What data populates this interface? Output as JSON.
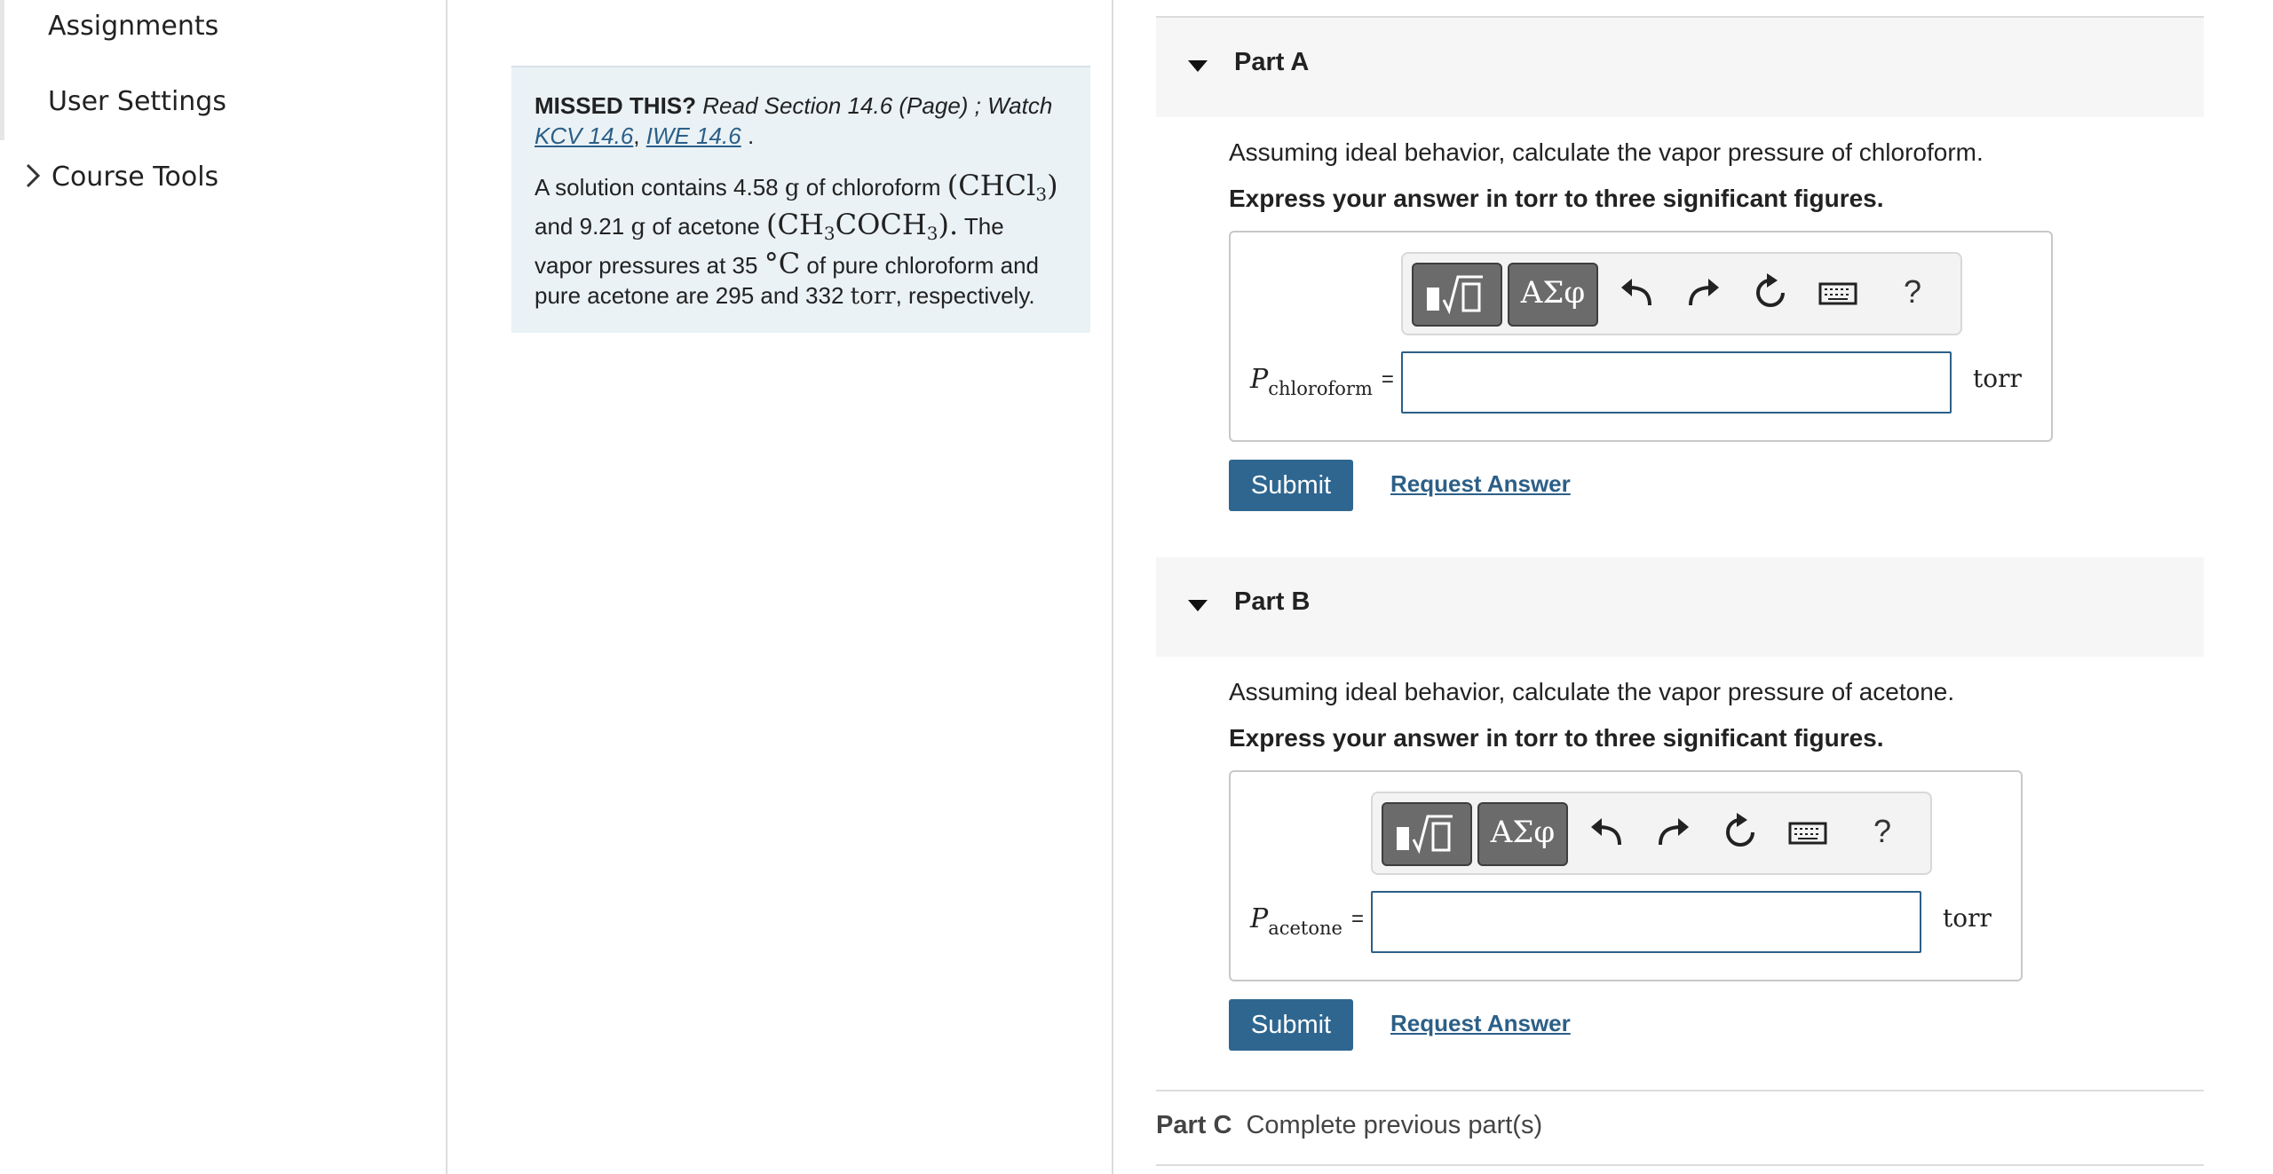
{
  "sidebar": {
    "items": [
      {
        "label": "Assignments"
      },
      {
        "label": "User Settings"
      },
      {
        "label": "Course Tools"
      }
    ]
  },
  "intro": {
    "missed_label": "MISSED THIS?",
    "read_text": "Read Section 14.6 (Page) ; Watch",
    "link1": "KCV 14.6",
    "comma": ",",
    "link2": "IWE 14.6",
    "period": ".",
    "problem": {
      "t1": "A solution contains 4.58",
      "u_g": "g",
      "t2": "of chloroform",
      "chcl3": "(CHCl",
      "sub3": "3",
      "close": ")",
      "t3": "and 9.21",
      "t4": "of acetone",
      "ch3": "(CH",
      "coch": "COCH",
      "close_dot": ").",
      "t5": "The vapor pressures at 35",
      "deg": "°C",
      "t6": "of pure chloroform and pure acetone are 295 and 332",
      "torr": "torr",
      "t7": ", respectively."
    }
  },
  "parts": [
    {
      "title": "Part A",
      "prompt": "Assuming ideal behavior, calculate the vapor pressure of chloroform.",
      "instruction": "Express your answer in torr to three significant figures.",
      "var_symbol": "P",
      "var_sub": "chloroform",
      "equals": "=",
      "value": "",
      "unit": "torr",
      "submit": "Submit",
      "request": "Request Answer",
      "toolbar": {
        "symbols_label": "ΑΣφ",
        "help_label": "?"
      }
    },
    {
      "title": "Part B",
      "prompt": "Assuming ideal behavior, calculate the vapor pressure of acetone.",
      "instruction": "Express your answer in torr to three significant figures.",
      "var_symbol": "P",
      "var_sub": "acetone",
      "equals": "=",
      "value": "",
      "unit": "torr",
      "submit": "Submit",
      "request": "Request Answer",
      "toolbar": {
        "symbols_label": "ΑΣφ",
        "help_label": "?"
      }
    }
  ],
  "part_c": {
    "title": "Part C",
    "status": "Complete previous part(s)"
  },
  "colors": {
    "accent": "#2e6690",
    "link": "#2c5f87",
    "intro_bg": "#eaf2f6",
    "header_bg": "#f6f6f6"
  },
  "icons": [
    "chevron-right-icon",
    "caret-down-icon",
    "template-icon",
    "undo-icon",
    "redo-icon",
    "reset-icon",
    "keyboard-icon",
    "help-icon"
  ]
}
